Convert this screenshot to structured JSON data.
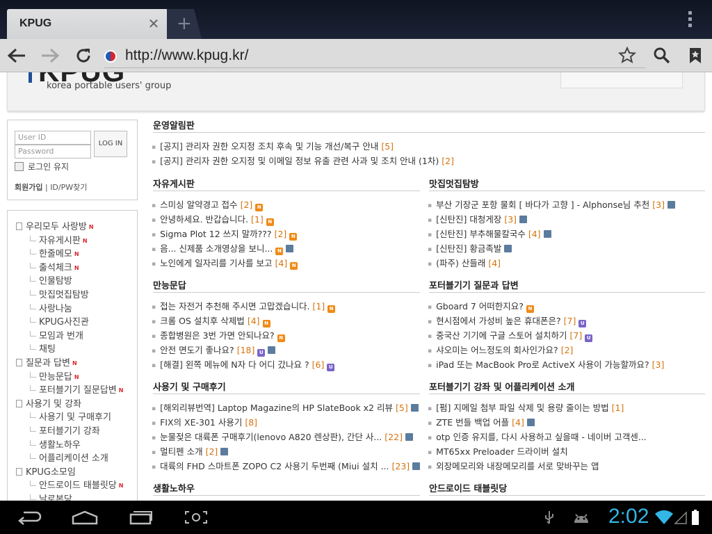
{
  "browser": {
    "tab_title": "KPUG",
    "url": "http://www.kpug.kr/"
  },
  "site": {
    "logo": "KPUG",
    "logo_sub": "korea portable users' group"
  },
  "login": {
    "user_id_placeholder": "User ID",
    "password_placeholder": "Password",
    "login_button": "LOG IN",
    "keep_login": "로그인 유지",
    "join": "회원가입",
    "find": "ID/PW찾기"
  },
  "menu": [
    {
      "label": "우리모두 사랑방",
      "level": 0,
      "new": true
    },
    {
      "label": "자유게시판",
      "level": 1,
      "new": true
    },
    {
      "label": "한줄메모",
      "level": 1,
      "new": true
    },
    {
      "label": "출석체크",
      "level": 1,
      "new": true
    },
    {
      "label": "인물탐방",
      "level": 1,
      "new": false
    },
    {
      "label": "맛집멋집탐방",
      "level": 1,
      "new": false
    },
    {
      "label": "사랑나눔",
      "level": 1,
      "new": false
    },
    {
      "label": "KPUG사진관",
      "level": 1,
      "new": false
    },
    {
      "label": "모임과 번개",
      "level": 1,
      "new": false
    },
    {
      "label": "채팅",
      "level": 1,
      "new": false
    },
    {
      "label": "질문과 답변",
      "level": 0,
      "new": true
    },
    {
      "label": "만능문답",
      "level": 1,
      "new": true
    },
    {
      "label": "포터블기기 질문답변",
      "level": 1,
      "new": true
    },
    {
      "label": "사용기 및 강좌",
      "level": 0,
      "new": false
    },
    {
      "label": "사용기 및 구매후기",
      "level": 1,
      "new": false
    },
    {
      "label": "포터블기기 강좌",
      "level": 1,
      "new": false
    },
    {
      "label": "생활노하우",
      "level": 1,
      "new": false
    },
    {
      "label": "어플리케이션 소개",
      "level": 1,
      "new": false
    },
    {
      "label": "KPUG소모임",
      "level": 0,
      "new": false
    },
    {
      "label": "안드로이드 태블릿당",
      "level": 1,
      "new": true
    },
    {
      "label": "날로본당",
      "level": 1,
      "new": false
    }
  ],
  "sections": [
    {
      "title": "운영알림판",
      "posts": [
        {
          "text": "[공지] 관리자 권한 오지정 조치 후속 및 기능 개선/복구 안내",
          "count": "[5]",
          "icons": []
        },
        {
          "text": "[공지] 관리자 권한 오지정 및 이메일 정보 유출 관련 사과 및 조치 안내 (1차)",
          "count": "[2]",
          "icons": []
        }
      ]
    },
    {
      "title": "자유게시판",
      "posts": [
        {
          "text": "스미싱 알약경고 접수",
          "count": "[2]",
          "icons": [
            "N"
          ]
        },
        {
          "text": "안녕하세요. 반갑습니다.",
          "count": "[1]",
          "icons": [
            "N"
          ]
        },
        {
          "text": "Sigma Plot 12 쓰지 말까???",
          "count": "[2]",
          "icons": [
            "N"
          ]
        },
        {
          "text": "음... 신제품 소개영상을 보니...",
          "count": "",
          "icons": [
            "N",
            "D"
          ]
        },
        {
          "text": "노인에게 일자리를 기사를 보고",
          "count": "[4]",
          "icons": [
            "N"
          ]
        }
      ]
    },
    {
      "title": "맛집멋집탐방",
      "posts": [
        {
          "text": "부산 기장군 포항 물회 [ 바다가 고향 ] - Alphonse님 추천",
          "count": "[3]",
          "icons": [
            "D"
          ]
        },
        {
          "text": "[신탄진] 대청게장",
          "count": "[3]",
          "icons": [
            "D"
          ]
        },
        {
          "text": "[신탄진] 부추해물칼국수",
          "count": "[4]",
          "icons": [
            "D"
          ]
        },
        {
          "text": "[신탄진] 황금족발",
          "count": "",
          "icons": [
            "D"
          ]
        },
        {
          "text": "(파주) 산들래",
          "count": "[4]",
          "icons": []
        }
      ]
    },
    {
      "title": "만능문답",
      "posts": [
        {
          "text": "접는 자전거 추천해 주시면 고맙겠습니다.",
          "count": "[1]",
          "icons": [
            "N"
          ]
        },
        {
          "text": "크롬 OS 설치후 삭제법",
          "count": "[4]",
          "icons": [
            "N"
          ]
        },
        {
          "text": "종합병원은 3번 가면 안되나요?",
          "count": "",
          "icons": [
            "N"
          ]
        },
        {
          "text": "안전 면도기 좋나요?",
          "count": "[18]",
          "icons": [
            "U",
            "D"
          ]
        },
        {
          "text": "[해결] 왼쪽 메뉴에 N자 다 어디 갔나요 ?",
          "count": "[6]",
          "icons": [
            "U"
          ]
        }
      ]
    },
    {
      "title": "포터블기기 질문과 답변",
      "posts": [
        {
          "text": "Gboard 7 어떠한지요?",
          "count": "",
          "icons": [
            "N"
          ]
        },
        {
          "text": "현시점에서 가성비 높은 휴대폰은?",
          "count": "[7]",
          "icons": [
            "U"
          ]
        },
        {
          "text": "중국산 기기에 구글 스토어 설치하기",
          "count": "[7]",
          "icons": [
            "U"
          ]
        },
        {
          "text": "샤오미는 어느정도의 회사인가요?",
          "count": "[2]",
          "icons": []
        },
        {
          "text": "iPad 또는 MacBook Pro로 ActiveX 사용이 가능할까요?",
          "count": "[3]",
          "icons": []
        }
      ]
    },
    {
      "title": "사용기 및 구매후기",
      "posts": [
        {
          "text": "[해외리뷰번역] Laptop Magazine의 HP SlateBook x2 리뷰",
          "count": "[5]",
          "icons": [
            "D"
          ]
        },
        {
          "text": "FIX의 XE-301 사용기",
          "count": "[8]",
          "icons": []
        },
        {
          "text": "눈물젖은 대륙폰 구매후기(lenovo A820 렌상판), 간단 사...",
          "count": "[22]",
          "icons": [
            "D"
          ]
        },
        {
          "text": "멀티펜 소개",
          "count": "[2]",
          "icons": [
            "D"
          ]
        },
        {
          "text": "대륙의 FHD 스마트폰 ZOPO C2 사용기 두번째 (Miui 설치 ...",
          "count": "[23]",
          "icons": [
            "D"
          ]
        }
      ]
    },
    {
      "title": "포터블기기 강좌 및 어플리케이션 소개",
      "posts": [
        {
          "text": "[펌] 지메일 첨부 파일 삭제 및 용량 줄이는 방법",
          "count": "[1]",
          "icons": []
        },
        {
          "text": "ZTE 번들 백업 어플",
          "count": "[4]",
          "icons": [
            "D"
          ]
        },
        {
          "text": "otp 인증 유지를, 다시 사용하고 싶을때 - 네이버 고객센...",
          "count": "",
          "icons": []
        },
        {
          "text": "MT65xx Preloader 드라이버 설치",
          "count": "",
          "icons": []
        },
        {
          "text": "외장메모리와 내장메모리를 서로 맞바꾸는 앱",
          "count": "",
          "icons": []
        }
      ]
    },
    {
      "title": "생활노하우",
      "posts": []
    },
    {
      "title": "안드로이드 태블릿당",
      "posts": []
    }
  ],
  "status": {
    "clock": "2:02"
  },
  "colors": {
    "accent_blue": "#33b5e5",
    "count_orange": "#d5730e",
    "new_badge": "#f08a16",
    "updated_badge": "#7a64c8"
  }
}
